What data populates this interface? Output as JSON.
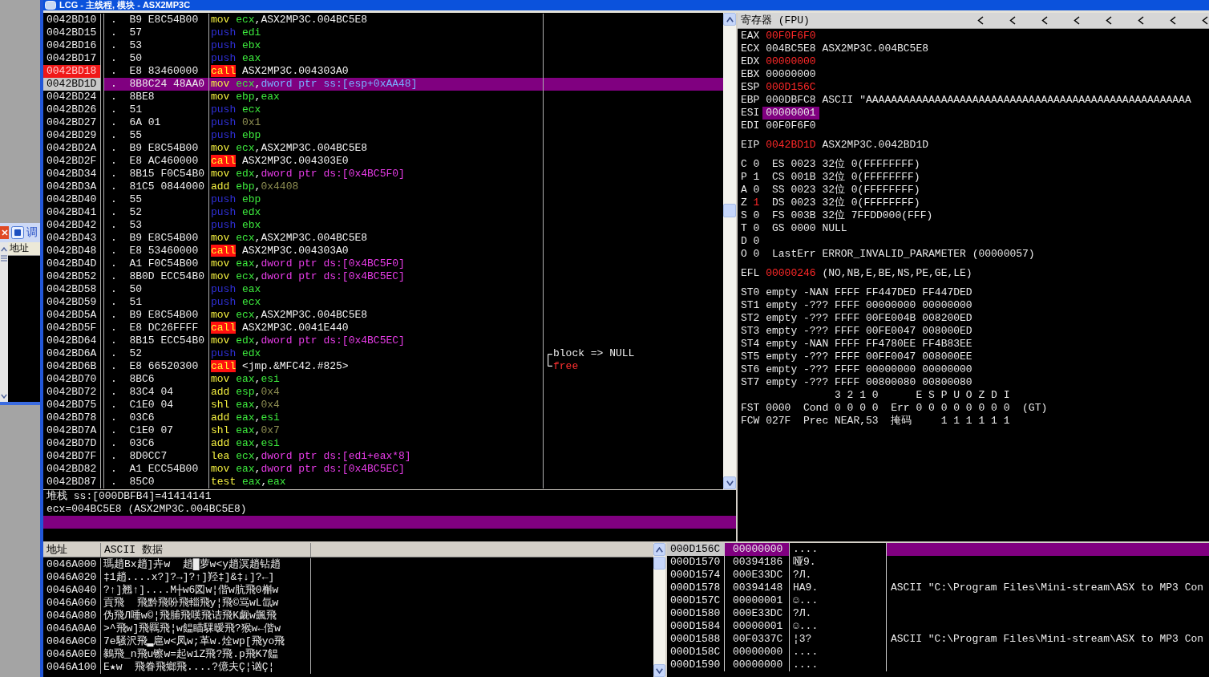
{
  "window": {
    "title": "LCG - 主线程, 模块 - ASX2MP3C"
  },
  "side_window": {
    "title": "调",
    "columns": [
      "地址"
    ]
  },
  "disassembly": {
    "rows": [
      {
        "address": "0042BD10",
        "hex": ".  B9 E8C54B00",
        "mnemonic": "mov",
        "kind": "normal",
        "operands": [
          {
            "kind": "reg",
            "text": "ecx"
          },
          {
            "kind": "sep",
            "text": ","
          },
          {
            "kind": "sym",
            "text": "ASX2MP3C.004BC5E8"
          }
        ],
        "breakpoint": false,
        "current": false,
        "selected": false
      },
      {
        "address": "0042BD15",
        "hex": ".  57",
        "mnemonic": "push",
        "kind": "push",
        "operands": [
          {
            "kind": "reg",
            "text": "edi"
          }
        ],
        "breakpoint": false,
        "current": false,
        "selected": false
      },
      {
        "address": "0042BD16",
        "hex": ".  53",
        "mnemonic": "push",
        "kind": "push",
        "operands": [
          {
            "kind": "reg",
            "text": "ebx"
          }
        ],
        "breakpoint": false,
        "current": false,
        "selected": false
      },
      {
        "address": "0042BD17",
        "hex": ".  50",
        "mnemonic": "push",
        "kind": "push",
        "operands": [
          {
            "kind": "reg",
            "text": "eax"
          }
        ],
        "breakpoint": false,
        "current": false,
        "selected": false
      },
      {
        "address": "0042BD18",
        "hex": ".  E8 83460000",
        "mnemonic": "call",
        "kind": "call",
        "operands": [
          {
            "kind": "sym",
            "text": "ASX2MP3C.004303A0"
          }
        ],
        "breakpoint": true,
        "current": false,
        "selected": false
      },
      {
        "address": "0042BD1D",
        "hex": ".  8B8C24 48AA0",
        "mnemonic": "mov",
        "kind": "normal",
        "operands": [
          {
            "kind": "reg",
            "text": "ecx"
          },
          {
            "kind": "sep",
            "text": ","
          },
          {
            "kind": "mem",
            "text": "dword ptr ss:[esp+0xAA48]"
          }
        ],
        "breakpoint": false,
        "current": true,
        "selected": true
      },
      {
        "address": "0042BD24",
        "hex": ".  8BE8",
        "mnemonic": "mov",
        "kind": "normal",
        "operands": [
          {
            "kind": "reg",
            "text": "ebp"
          },
          {
            "kind": "sep",
            "text": ","
          },
          {
            "kind": "reg",
            "text": "eax"
          }
        ],
        "breakpoint": false,
        "current": false,
        "selected": false
      },
      {
        "address": "0042BD26",
        "hex": ".  51",
        "mnemonic": "push",
        "kind": "push",
        "operands": [
          {
            "kind": "reg",
            "text": "ecx"
          }
        ],
        "breakpoint": false,
        "current": false,
        "selected": false
      },
      {
        "address": "0042BD27",
        "hex": ".  6A 01",
        "mnemonic": "push",
        "kind": "push",
        "operands": [
          {
            "kind": "imm",
            "text": "0x1"
          }
        ],
        "breakpoint": false,
        "current": false,
        "selected": false
      },
      {
        "address": "0042BD29",
        "hex": ".  55",
        "mnemonic": "push",
        "kind": "push",
        "operands": [
          {
            "kind": "reg",
            "text": "ebp"
          }
        ],
        "breakpoint": false,
        "current": false,
        "selected": false
      },
      {
        "address": "0042BD2A",
        "hex": ".  B9 E8C54B00",
        "mnemonic": "mov",
        "kind": "normal",
        "operands": [
          {
            "kind": "reg",
            "text": "ecx"
          },
          {
            "kind": "sep",
            "text": ","
          },
          {
            "kind": "sym",
            "text": "ASX2MP3C.004BC5E8"
          }
        ],
        "breakpoint": false,
        "current": false,
        "selected": false
      },
      {
        "address": "0042BD2F",
        "hex": ".  E8 AC460000",
        "mnemonic": "call",
        "kind": "call",
        "operands": [
          {
            "kind": "sym",
            "text": "ASX2MP3C.004303E0"
          }
        ],
        "breakpoint": false,
        "current": false,
        "selected": false
      },
      {
        "address": "0042BD34",
        "hex": ".  8B15 F0C54B0",
        "mnemonic": "mov",
        "kind": "normal",
        "operands": [
          {
            "kind": "reg",
            "text": "edx"
          },
          {
            "kind": "sep",
            "text": ","
          },
          {
            "kind": "mem",
            "text": "dword ptr ds:[0x4BC5F0]"
          }
        ],
        "breakpoint": false,
        "current": false,
        "selected": false
      },
      {
        "address": "0042BD3A",
        "hex": ".  81C5 0844000",
        "mnemonic": "add",
        "kind": "normal",
        "operands": [
          {
            "kind": "reg",
            "text": "ebp"
          },
          {
            "kind": "sep",
            "text": ","
          },
          {
            "kind": "imm",
            "text": "0x4408"
          }
        ],
        "breakpoint": false,
        "current": false,
        "selected": false
      },
      {
        "address": "0042BD40",
        "hex": ".  55",
        "mnemonic": "push",
        "kind": "push",
        "operands": [
          {
            "kind": "reg",
            "text": "ebp"
          }
        ],
        "breakpoint": false,
        "current": false,
        "selected": false
      },
      {
        "address": "0042BD41",
        "hex": ".  52",
        "mnemonic": "push",
        "kind": "push",
        "operands": [
          {
            "kind": "reg",
            "text": "edx"
          }
        ],
        "breakpoint": false,
        "current": false,
        "selected": false
      },
      {
        "address": "0042BD42",
        "hex": ".  53",
        "mnemonic": "push",
        "kind": "push",
        "operands": [
          {
            "kind": "reg",
            "text": "ebx"
          }
        ],
        "breakpoint": false,
        "current": false,
        "selected": false
      },
      {
        "address": "0042BD43",
        "hex": ".  B9 E8C54B00",
        "mnemonic": "mov",
        "kind": "normal",
        "operands": [
          {
            "kind": "reg",
            "text": "ecx"
          },
          {
            "kind": "sep",
            "text": ","
          },
          {
            "kind": "sym",
            "text": "ASX2MP3C.004BC5E8"
          }
        ],
        "breakpoint": false,
        "current": false,
        "selected": false
      },
      {
        "address": "0042BD48",
        "hex": ".  E8 53460000",
        "mnemonic": "call",
        "kind": "call",
        "operands": [
          {
            "kind": "sym",
            "text": "ASX2MP3C.004303A0"
          }
        ],
        "breakpoint": false,
        "current": false,
        "selected": false
      },
      {
        "address": "0042BD4D",
        "hex": ".  A1 F0C54B00",
        "mnemonic": "mov",
        "kind": "normal",
        "operands": [
          {
            "kind": "reg",
            "text": "eax"
          },
          {
            "kind": "sep",
            "text": ","
          },
          {
            "kind": "mem",
            "text": "dword ptr ds:[0x4BC5F0]"
          }
        ],
        "breakpoint": false,
        "current": false,
        "selected": false
      },
      {
        "address": "0042BD52",
        "hex": ".  8B0D ECC54B0",
        "mnemonic": "mov",
        "kind": "normal",
        "operands": [
          {
            "kind": "reg",
            "text": "ecx"
          },
          {
            "kind": "sep",
            "text": ","
          },
          {
            "kind": "mem",
            "text": "dword ptr ds:[0x4BC5EC]"
          }
        ],
        "breakpoint": false,
        "current": false,
        "selected": false
      },
      {
        "address": "0042BD58",
        "hex": ".  50",
        "mnemonic": "push",
        "kind": "push",
        "operands": [
          {
            "kind": "reg",
            "text": "eax"
          }
        ],
        "breakpoint": false,
        "current": false,
        "selected": false
      },
      {
        "address": "0042BD59",
        "hex": ".  51",
        "mnemonic": "push",
        "kind": "push",
        "operands": [
          {
            "kind": "reg",
            "text": "ecx"
          }
        ],
        "breakpoint": false,
        "current": false,
        "selected": false
      },
      {
        "address": "0042BD5A",
        "hex": ".  B9 E8C54B00",
        "mnemonic": "mov",
        "kind": "normal",
        "operands": [
          {
            "kind": "reg",
            "text": "ecx"
          },
          {
            "kind": "sep",
            "text": ","
          },
          {
            "kind": "sym",
            "text": "ASX2MP3C.004BC5E8"
          }
        ],
        "breakpoint": false,
        "current": false,
        "selected": false
      },
      {
        "address": "0042BD5F",
        "hex": ".  E8 DC26FFFF",
        "mnemonic": "call",
        "kind": "call",
        "operands": [
          {
            "kind": "sym",
            "text": "ASX2MP3C.0041E440"
          }
        ],
        "breakpoint": false,
        "current": false,
        "selected": false
      },
      {
        "address": "0042BD64",
        "hex": ".  8B15 ECC54B0",
        "mnemonic": "mov",
        "kind": "normal",
        "operands": [
          {
            "kind": "reg",
            "text": "edx"
          },
          {
            "kind": "sep",
            "text": ","
          },
          {
            "kind": "mem",
            "text": "dword ptr ds:[0x4BC5EC]"
          }
        ],
        "breakpoint": false,
        "current": false,
        "selected": false
      },
      {
        "address": "0042BD6A",
        "hex": ".  52",
        "mnemonic": "push",
        "kind": "push",
        "operands": [
          {
            "kind": "reg",
            "text": "edx"
          }
        ],
        "breakpoint": false,
        "current": false,
        "selected": false,
        "comment": {
          "text": "block => NULL",
          "kind": "arg",
          "bracket_start": true
        }
      },
      {
        "address": "0042BD6B",
        "hex": ".  E8 66520300",
        "mnemonic": "call",
        "kind": "call",
        "operands": [
          {
            "kind": "sym",
            "text": "<jmp.&MFC42.#825>"
          }
        ],
        "breakpoint": false,
        "current": false,
        "selected": false,
        "comment": {
          "text": "free",
          "kind": "func",
          "bracket_start": false
        }
      },
      {
        "address": "0042BD70",
        "hex": ".  8BC6",
        "mnemonic": "mov",
        "kind": "normal",
        "operands": [
          {
            "kind": "reg",
            "text": "eax"
          },
          {
            "kind": "sep",
            "text": ","
          },
          {
            "kind": "reg",
            "text": "esi"
          }
        ],
        "breakpoint": false,
        "current": false,
        "selected": false
      },
      {
        "address": "0042BD72",
        "hex": ".  83C4 04",
        "mnemonic": "add",
        "kind": "normal",
        "operands": [
          {
            "kind": "reg",
            "text": "esp"
          },
          {
            "kind": "sep",
            "text": ","
          },
          {
            "kind": "imm",
            "text": "0x4"
          }
        ],
        "breakpoint": false,
        "current": false,
        "selected": false
      },
      {
        "address": "0042BD75",
        "hex": ".  C1E0 04",
        "mnemonic": "shl",
        "kind": "normal",
        "operands": [
          {
            "kind": "reg",
            "text": "eax"
          },
          {
            "kind": "sep",
            "text": ","
          },
          {
            "kind": "imm",
            "text": "0x4"
          }
        ],
        "breakpoint": false,
        "current": false,
        "selected": false
      },
      {
        "address": "0042BD78",
        "hex": ".  03C6",
        "mnemonic": "add",
        "kind": "normal",
        "operands": [
          {
            "kind": "reg",
            "text": "eax"
          },
          {
            "kind": "sep",
            "text": ","
          },
          {
            "kind": "reg",
            "text": "esi"
          }
        ],
        "breakpoint": false,
        "current": false,
        "selected": false
      },
      {
        "address": "0042BD7A",
        "hex": ".  C1E0 07",
        "mnemonic": "shl",
        "kind": "normal",
        "operands": [
          {
            "kind": "reg",
            "text": "eax"
          },
          {
            "kind": "sep",
            "text": ","
          },
          {
            "kind": "imm",
            "text": "0x7"
          }
        ],
        "breakpoint": false,
        "current": false,
        "selected": false
      },
      {
        "address": "0042BD7D",
        "hex": ".  03C6",
        "mnemonic": "add",
        "kind": "normal",
        "operands": [
          {
            "kind": "reg",
            "text": "eax"
          },
          {
            "kind": "sep",
            "text": ","
          },
          {
            "kind": "reg",
            "text": "esi"
          }
        ],
        "breakpoint": false,
        "current": false,
        "selected": false
      },
      {
        "address": "0042BD7F",
        "hex": ".  8D0CC7",
        "mnemonic": "lea",
        "kind": "normal",
        "operands": [
          {
            "kind": "reg",
            "text": "ecx"
          },
          {
            "kind": "sep",
            "text": ","
          },
          {
            "kind": "mem",
            "text": "dword ptr ds:[edi+eax*8]"
          }
        ],
        "breakpoint": false,
        "current": false,
        "selected": false
      },
      {
        "address": "0042BD82",
        "hex": ".  A1 ECC54B00",
        "mnemonic": "mov",
        "kind": "normal",
        "operands": [
          {
            "kind": "reg",
            "text": "eax"
          },
          {
            "kind": "sep",
            "text": ","
          },
          {
            "kind": "mem",
            "text": "dword ptr ds:[0x4BC5EC]"
          }
        ],
        "breakpoint": false,
        "current": false,
        "selected": false
      },
      {
        "address": "0042BD87",
        "hex": ".  85C0",
        "mnemonic": "test",
        "kind": "normal",
        "operands": [
          {
            "kind": "reg",
            "text": "eax"
          },
          {
            "kind": "sep",
            "text": ","
          },
          {
            "kind": "reg",
            "text": "eax"
          }
        ],
        "breakpoint": false,
        "current": false,
        "selected": false
      }
    ]
  },
  "info": {
    "lines": [
      "堆栈 ss:[000DBFB4]=41414141",
      "ecx=004BC5E8 (ASX2MP3C.004BC5E8)"
    ]
  },
  "registers": {
    "title": "寄存器 (FPU)",
    "general": [
      {
        "name": "EAX",
        "value": "00F0F6F0",
        "changed": true,
        "selected": false
      },
      {
        "name": "ECX",
        "value": "004BC5E8",
        "changed": false,
        "selected": false,
        "comment": "ASX2MP3C.004BC5E8"
      },
      {
        "name": "EDX",
        "value": "00000000",
        "changed": true,
        "selected": false
      },
      {
        "name": "EBX",
        "value": "00000000",
        "changed": false,
        "selected": false
      },
      {
        "name": "ESP",
        "value": "000D156C",
        "changed": true,
        "selected": false
      },
      {
        "name": "EBP",
        "value": "000DBFC8",
        "changed": false,
        "selected": false,
        "comment": "ASCII \"AAAAAAAAAAAAAAAAAAAAAAAAAAAAAAAAAAAAAAAAAAAAAAAAAAAA"
      },
      {
        "name": "ESI",
        "value": "00000001",
        "changed": false,
        "selected": true
      },
      {
        "name": "EDI",
        "value": "00F0F6F0",
        "changed": false,
        "selected": false
      }
    ],
    "eip": {
      "name": "EIP",
      "value": "0042BD1D",
      "changed": true,
      "comment": "ASX2MP3C.0042BD1D"
    },
    "flags": [
      {
        "name": "C",
        "value": "0",
        "changed": false,
        "detail": "ES 0023 32位 0(FFFFFFFF)"
      },
      {
        "name": "P",
        "value": "1",
        "changed": false,
        "detail": "CS 001B 32位 0(FFFFFFFF)"
      },
      {
        "name": "A",
        "value": "0",
        "changed": false,
        "detail": "SS 0023 32位 0(FFFFFFFF)"
      },
      {
        "name": "Z",
        "value": "1",
        "changed": true,
        "detail": "DS 0023 32位 0(FFFFFFFF)"
      },
      {
        "name": "S",
        "value": "0",
        "changed": false,
        "detail": "FS 003B 32位 7FFDD000(FFF)"
      },
      {
        "name": "T",
        "value": "0",
        "changed": false,
        "detail": "GS 0000 NULL"
      },
      {
        "name": "D",
        "value": "0",
        "changed": false
      },
      {
        "name": "O",
        "value": "0",
        "changed": false,
        "detail": "LastErr ERROR_INVALID_PARAMETER (00000057)"
      }
    ],
    "efl": {
      "name": "EFL",
      "value": "00000246",
      "changed": true,
      "comment": "(NO,NB,E,BE,NS,PE,GE,LE)"
    },
    "fpu": [
      {
        "name": "ST0",
        "tag": "empty",
        "value": "-NAN FFFF FF447DED FF447DED"
      },
      {
        "name": "ST1",
        "tag": "empty",
        "value": "-??? FFFF 00000000 00000000"
      },
      {
        "name": "ST2",
        "tag": "empty",
        "value": "-??? FFFF 00FE004B 008200ED"
      },
      {
        "name": "ST3",
        "tag": "empty",
        "value": "-??? FFFF 00FE0047 008000ED"
      },
      {
        "name": "ST4",
        "tag": "empty",
        "value": "-NAN FFFF FF4780EE FF4B83EE"
      },
      {
        "name": "ST5",
        "tag": "empty",
        "value": "-??? FFFF 00FF0047 008000EE"
      },
      {
        "name": "ST6",
        "tag": "empty",
        "value": "-??? FFFF 00000000 00000000"
      },
      {
        "name": "ST7",
        "tag": "empty",
        "value": "-??? FFFF 00800080 00800080"
      }
    ],
    "fpu_status": {
      "cond_header": "3 2 1 0",
      "err_header": "E S P U O Z D I",
      "fst": {
        "name": "FST",
        "value": "0000",
        "cond_label": "Cond",
        "cond": "0 0 0 0",
        "err_label": "Err",
        "err": "0 0 0 0 0 0 0 0",
        "result": "(GT)"
      },
      "fcw": {
        "name": "FCW",
        "value": "027F",
        "prec_label": "Prec",
        "prec": "NEAR,53",
        "mask_label": "掩码",
        "mask": "1 1 1 1 1 1"
      }
    }
  },
  "dump": {
    "columns": [
      "地址",
      "ASCII 数据"
    ],
    "rows": [
      {
        "address": "0046A000",
        "ascii": "瑪趙Bx趙]卉w  趙█萝w<y趙溟趙钻趙"
      },
      {
        "address": "0046A020",
        "ascii": "‡1趙....x?]?→]?↑]羟‡]&‡↓]?←]"
      },
      {
        "address": "0046A040",
        "ascii": "?↑]翘↑]....M┼w6図w¦偕w肮飛0槲w"
      },
      {
        "address": "0046A060",
        "ascii": "貢飛  飛黔飛吩飛輜飛y¦飛©骂wL氙w"
      },
      {
        "address": "0046A080",
        "ascii": "伪飛Л唾w©¦飛脯飛嘆飛诘飛K觑w颽飛"
      },
      {
        "address": "0046A0A0",
        "ascii": ">^飛w]飛羈飛¦w饂瞄騍暧飛?猴w←偕w"
      },
      {
        "address": "0046A0C0",
        "ascii": "7e騒沢飛▂扈w<凤w;革w.烇wp[飛yo飛"
      },
      {
        "address": "0046A0E0",
        "ascii": "鶨飛_n飛u镲w=起wiZ飛?飛.p飛K7饂"
      },
      {
        "address": "0046A100",
        "ascii": "E★w  飛眷飛鄉飛....?億夫Ç¦讻Ç¦"
      }
    ]
  },
  "stack": {
    "rows": [
      {
        "address": "000D156C",
        "value": "00000000",
        "ascii": "....",
        "selected": true
      },
      {
        "address": "000D1570",
        "value": "00394186",
        "ascii": "哑9.",
        "selected": false
      },
      {
        "address": "000D1574",
        "value": "000E33DC",
        "ascii": "?Л.",
        "selected": false
      },
      {
        "address": "000D1578",
        "value": "00394148",
        "ascii": "HA9.",
        "comment": "ASCII \"C:\\Program Files\\Mini-stream\\ASX to MP3 Con",
        "selected": false
      },
      {
        "address": "000D157C",
        "value": "00000001",
        "ascii": "☺...",
        "selected": false
      },
      {
        "address": "000D1580",
        "value": "000E33DC",
        "ascii": "?Л.",
        "selected": false
      },
      {
        "address": "000D1584",
        "value": "00000001",
        "ascii": "☺...",
        "selected": false
      },
      {
        "address": "000D1588",
        "value": "00F0337C",
        "ascii": "¦3?",
        "comment": "ASCII \"C:\\Program Files\\Mini-stream\\ASX to MP3 Con",
        "selected": false
      },
      {
        "address": "000D158C",
        "value": "00000000",
        "ascii": "....",
        "selected": false
      },
      {
        "address": "000D1590",
        "value": "00000000",
        "ascii": "....",
        "selected": false
      }
    ]
  }
}
